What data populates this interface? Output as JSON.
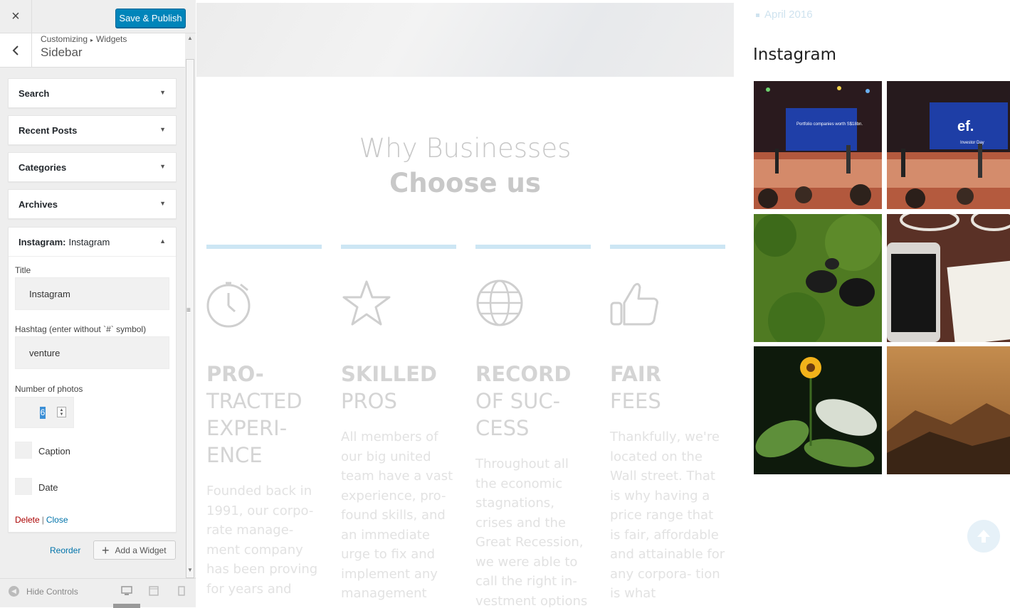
{
  "customizer": {
    "close_icon": "×",
    "publish_label": "Save & Publish",
    "back_icon": "‹",
    "breadcrumb": {
      "root": "Customizing",
      "sep": "▸",
      "panel": "Widgets"
    },
    "section_title": "Sidebar",
    "widgets": [
      {
        "title": "Search"
      },
      {
        "title": "Recent Posts"
      },
      {
        "title": "Categories"
      },
      {
        "title": "Archives"
      }
    ],
    "instagram_widget": {
      "title_prefix": "Instagram:",
      "title_sub": "Instagram",
      "fields": {
        "title_label": "Title",
        "title_value": "Instagram",
        "hashtag_label": "Hashtag (enter without `#` symbol)",
        "hashtag_value": "venture",
        "photos_label": "Number of photos",
        "photos_value": "6",
        "caption_label": "Caption",
        "date_label": "Date"
      },
      "delete_label": "Delete",
      "separator": "|",
      "close_label": "Close"
    },
    "reorder_label": "Reorder",
    "add_widget_label": "Add a Widget",
    "hide_controls_label": "Hide Controls"
  },
  "preview": {
    "heading_light": "Why Businesses",
    "heading_bold": "Choose us",
    "columns": [
      {
        "icon": "stopwatch-icon",
        "bold": "PRO-",
        "light": "TRACTED EXPERI- ENCE",
        "text": "Founded back in 1991, our corpo- rate manage- ment company has been proving for years and"
      },
      {
        "icon": "star-icon",
        "bold": "SKILLED",
        "light": "PROS",
        "text": "All members of our big united team have a vast experience, pro- found skills, and an immediate urge to fix and implement any management"
      },
      {
        "icon": "globe-icon",
        "bold": "RECORD",
        "light": "OF SUC- CESS",
        "text": "Throughout all the economic stagnations, crises and the Great Recession, we were able to call the right in- vestment options"
      },
      {
        "icon": "thumbs-up-icon",
        "bold": "FAIR",
        "light": "FEES",
        "text": "Thankfully, we're located on the Wall street. That is why having a price range that is fair, affordable and attainable for any corpora- tion is what"
      }
    ],
    "sidebar": {
      "archive_item": "April 2016",
      "instagram_title": "Instagram",
      "photo_texts": [
        "Portfolio companies worth S$18bn.",
        "ef.",
        "Investor Day"
      ]
    }
  }
}
